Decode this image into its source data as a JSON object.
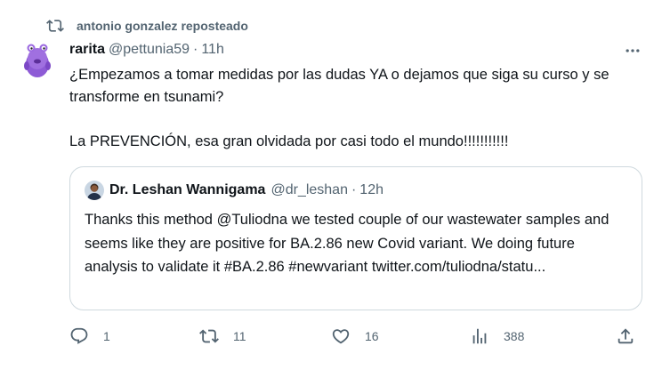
{
  "repost": {
    "text": "antonio gonzalez reposteado",
    "icon": "repost-icon"
  },
  "post": {
    "author_name": "rarita",
    "author_handle": "@pettunia59",
    "separator": "·",
    "time": "11h",
    "text_line1": "¿Empezamos a tomar medidas por las dudas YA o dejamos que siga su curso y se transforme en tsunami?",
    "text_line2": "La PREVENCIÓN,  esa gran olvidada por casi todo el mundo!!!!!!!!!!!"
  },
  "quote": {
    "author_name": "Dr. Leshan Wannigama",
    "author_handle": "@dr_leshan",
    "separator": "·",
    "time": "12h",
    "text": "Thanks this method @Tuliodna we tested couple of our wastewater samples and seems like they are positive for BA.2.86 new Covid variant. We doing future analysis to validate it  #BA.2.86 #newvariant twitter.com/tuliodna/statu..."
  },
  "actions": {
    "replies": "1",
    "reposts": "11",
    "likes": "16",
    "views": "388"
  },
  "colors": {
    "text": "#0f1419",
    "secondary": "#536471",
    "border": "#cfd9de",
    "avatar_purple": "#8e5bd6"
  }
}
